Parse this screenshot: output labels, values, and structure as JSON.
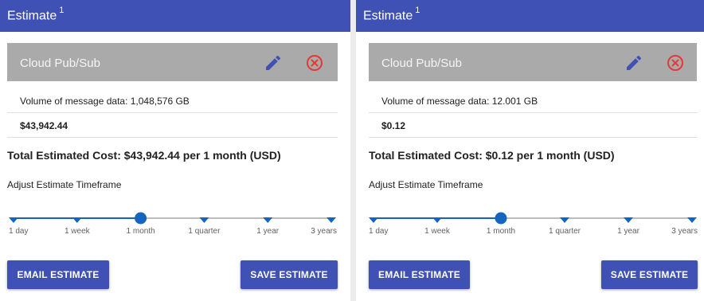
{
  "colors": {
    "primary": "#3f51b5",
    "slider": "#1565c0",
    "delete": "#e53935",
    "item_bar": "#aaaaaa"
  },
  "panels": [
    {
      "title": "Estimate",
      "title_sup": "1",
      "item": {
        "name": "Cloud Pub/Sub",
        "detail": "Volume of message data: 1,048,576 GB",
        "price": "$43,942.44",
        "edit_icon": "pencil-icon",
        "delete_icon": "circle-x-icon"
      },
      "total": "Total Estimated Cost: $43,942.44 per 1 month (USD)",
      "adjust_label": "Adjust Estimate Timeframe",
      "timeframes": [
        "1 day",
        "1 week",
        "1 month",
        "1 quarter",
        "1 year",
        "3 years"
      ],
      "selected_index": 2,
      "email_button": "EMAIL ESTIMATE",
      "save_button": "SAVE ESTIMATE"
    },
    {
      "title": "Estimate",
      "title_sup": "1",
      "item": {
        "name": "Cloud Pub/Sub",
        "detail": "Volume of message data: 12.001 GB",
        "price": "$0.12",
        "edit_icon": "pencil-icon",
        "delete_icon": "circle-x-icon"
      },
      "total": "Total Estimated Cost: $0.12 per 1 month (USD)",
      "adjust_label": "Adjust Estimate Timeframe",
      "timeframes": [
        "1 day",
        "1 week",
        "1 month",
        "1 quarter",
        "1 year",
        "3 years"
      ],
      "selected_index": 2,
      "email_button": "EMAIL ESTIMATE",
      "save_button": "SAVE ESTIMATE"
    }
  ]
}
